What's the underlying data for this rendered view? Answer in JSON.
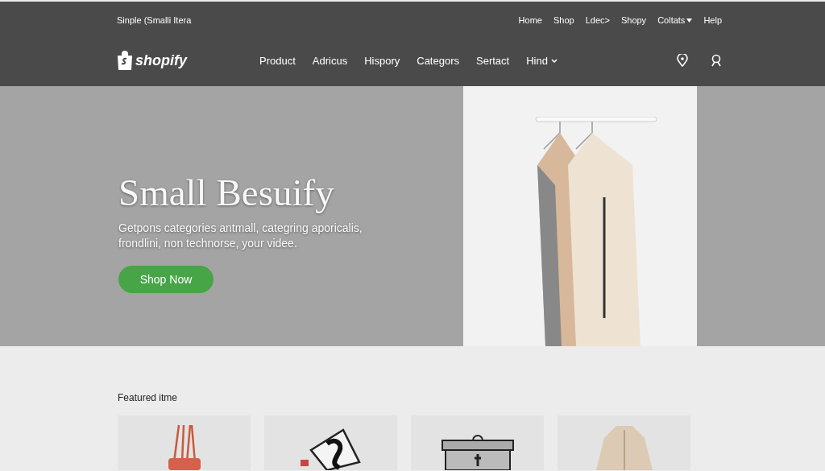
{
  "top_bar": {
    "tagline": "Sinple (Smalli Itera",
    "links": [
      {
        "label": "Home",
        "has_menu": false
      },
      {
        "label": "Shop",
        "has_menu": false
      },
      {
        "label": "Ldec>",
        "has_menu": false
      },
      {
        "label": "Shopy",
        "has_menu": false
      },
      {
        "label": "Coltats",
        "has_menu": true
      },
      {
        "label": "Help",
        "has_menu": false
      }
    ]
  },
  "nav": {
    "logo": "shopify",
    "items": [
      {
        "label": "Product",
        "has_menu": false
      },
      {
        "label": "Adricus",
        "has_menu": false
      },
      {
        "label": "Hispory",
        "has_menu": false
      },
      {
        "label": "Categors",
        "has_menu": false
      },
      {
        "label": "Sertact",
        "has_menu": false
      },
      {
        "label": "Hind",
        "has_menu": true
      }
    ]
  },
  "hero": {
    "title": "Small Besuify",
    "text": "Getpons categories antmall, categring aporicalis, frondlini, non technorse, your videe.",
    "button": "Shop Now"
  },
  "featured": {
    "heading": "Featured itme",
    "items": [
      {
        "kind": "handbag"
      },
      {
        "kind": "case"
      },
      {
        "kind": "bin"
      },
      {
        "kind": "coat"
      }
    ]
  }
}
